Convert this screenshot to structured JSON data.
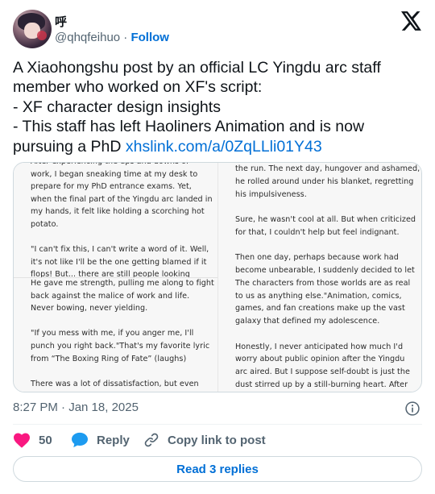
{
  "author": {
    "display_name": "呼",
    "handle": "@qhqfeihuo",
    "separator": "·",
    "follow_label": "Follow"
  },
  "tweet": {
    "lines": [
      "A Xiaohongshu post by an official LC Yingdu arc staff",
      "member who worked on XF's script:",
      "- XF character design insights",
      "- This staff  has left Haoliners Animation and is now"
    ],
    "last_line_text": "pursuing a PhD ",
    "link_text": "xhslink.com/a/0ZqLLli01Y43"
  },
  "media": {
    "left_top": [
      "After experiencing the ups and downs of",
      "work, I began sneaking time at my desk to",
      "prepare for my PhD entrance exams. Yet,",
      "when the final part of the Yingdu arc landed in",
      "my hands, it felt like holding a scorching hot",
      "potato.",
      "",
      "\"I can't fix this, I can't write a word of it. Well,",
      "it's not like I'll be the one getting blamed if it",
      "flops! But... there are still people looking"
    ],
    "left_bottom": [
      "He gave me strength, pulling me along to fight",
      "back against the malice of work and life.",
      "Never bowing, never yielding.",
      "",
      "\"If you mess with me, if you anger me, I'll",
      "punch you right back.\"That's my favorite lyric",
      "from “The Boxing Ring of Fate” (laughs)",
      "",
      "There was a lot of dissatisfaction, but even"
    ],
    "right": [
      "the run. The next day, hungover and ashamed,",
      "he rolled around under his blanket, regretting",
      "his impulsiveness.",
      "",
      "Sure, he wasn't cool at all. But when criticized",
      "for that, I couldn't help but feel indignant.",
      "",
      "Then one day, perhaps because work had",
      "become unbearable, I suddenly decided to let",
      "The characters from those worlds are as real",
      "to us as anything else.\"Animation, comics,",
      "games, and fan creations make up the vast",
      "galaxy that defined my adolescence.",
      "",
      "Honestly, I never anticipated how much I'd",
      "worry about public opinion after the Yingdu",
      "arc aired. But I suppose self-doubt is just the",
      "dust stirred up by a still-burning heart. After"
    ]
  },
  "timestamp": "8:27 PM · Jan 18, 2025",
  "actions": {
    "likes_count": "50",
    "reply_label": "Reply",
    "copy_link_label": "Copy link to post"
  },
  "read_replies_label": "Read 3 replies",
  "colors": {
    "link": "#006fd6",
    "like": "#f91880",
    "reply": "#1d9bf0",
    "muted": "#536471"
  },
  "icons": [
    "x-logo-icon",
    "info-icon",
    "heart-icon",
    "reply-bubble-icon",
    "link-icon"
  ]
}
